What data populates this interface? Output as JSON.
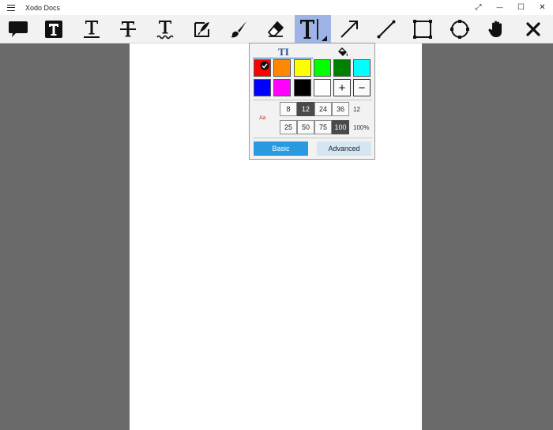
{
  "app": {
    "title": "Xodo Docs"
  },
  "window": {
    "expand_glyph": "⤢",
    "minimize_glyph": "—",
    "maximize_glyph": "☐",
    "close_glyph": "✕"
  },
  "toolbar": {
    "tools": [
      {
        "name": "sticky-note-tool-button",
        "icon": "speech-bubble-icon"
      },
      {
        "name": "free-text-tool-button",
        "icon": "text-box-icon"
      },
      {
        "name": "underline-tool-button",
        "icon": "underline-icon"
      },
      {
        "name": "strikeout-tool-button",
        "icon": "strikethrough-icon"
      },
      {
        "name": "squiggly-tool-button",
        "icon": "squiggly-underline-icon"
      },
      {
        "name": "signature-tool-button",
        "icon": "signature-icon"
      },
      {
        "name": "ink-tool-button",
        "icon": "brush-icon"
      },
      {
        "name": "eraser-tool-button",
        "icon": "eraser-icon"
      },
      {
        "name": "text-tool-button",
        "icon": "text-cursor-icon",
        "active": true
      },
      {
        "name": "arrow-tool-button",
        "icon": "arrow-icon"
      },
      {
        "name": "line-tool-button",
        "icon": "line-icon"
      },
      {
        "name": "rectangle-tool-button",
        "icon": "rectangle-icon"
      },
      {
        "name": "ellipse-tool-button",
        "icon": "ellipse-icon"
      },
      {
        "name": "pan-tool-button",
        "icon": "hand-icon"
      },
      {
        "name": "close-toolbar-button",
        "icon": "close-icon"
      }
    ]
  },
  "popup": {
    "tabs": {
      "text_color": "TI",
      "fill_color": "paint-bucket-icon"
    },
    "colors": {
      "row1": [
        "#ff0000",
        "#ff8800",
        "#ffff00",
        "#00ff00",
        "#008000",
        "#00ffff"
      ],
      "row2": [
        "#0000ff",
        "#ff00ff",
        "#000000",
        "#ffffff"
      ],
      "selected": "#ff0000"
    },
    "add_label": "+",
    "remove_label": "−",
    "preview_label": "Aa",
    "font_sizes": [
      "8",
      "12",
      "24",
      "36"
    ],
    "selected_font_size": "12",
    "font_size_value": "12",
    "opacity_options": [
      "25",
      "50",
      "75",
      "100"
    ],
    "selected_opacity": "100",
    "opacity_value": "100%",
    "basic_label": "Basic",
    "advanced_label": "Advanced"
  }
}
